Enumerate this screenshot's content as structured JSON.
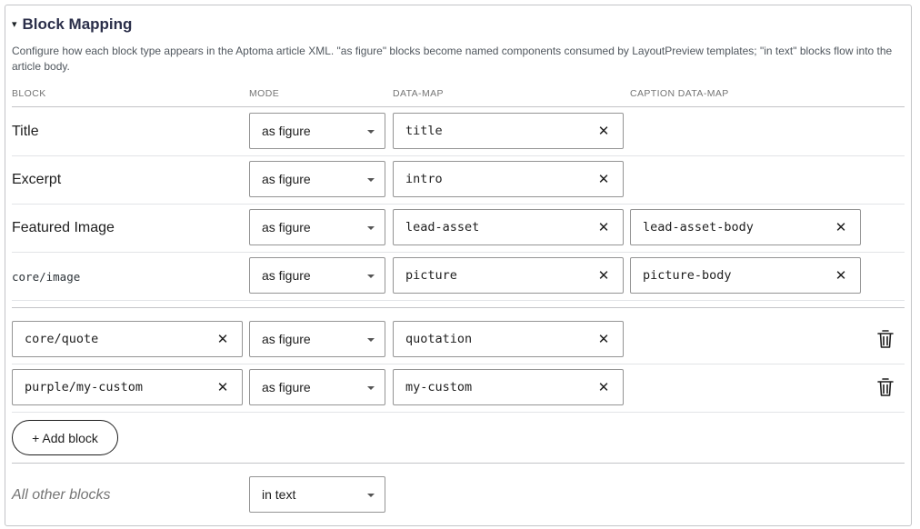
{
  "panel": {
    "title": "Block Mapping",
    "caret": "▾",
    "description": "Configure how each block type appears in the Aptoma article XML. \"as figure\" blocks become named components consumed by LayoutPreview templates; \"in text\" blocks flow into the article body."
  },
  "columns": {
    "block": "BLOCK",
    "mode": "MODE",
    "data_map": "DATA-MAP",
    "caption_data_map": "CAPTION DATA-MAP"
  },
  "builtin_rows": [
    {
      "label": "Title",
      "mode": "as figure",
      "data_map": "title",
      "caption": null
    },
    {
      "label": "Excerpt",
      "mode": "as figure",
      "data_map": "intro",
      "caption": null
    },
    {
      "label": "Featured Image",
      "mode": "as figure",
      "data_map": "lead-asset",
      "caption": "lead-asset-body"
    },
    {
      "label": "core/image",
      "mode": "as figure",
      "data_map": "picture",
      "caption": "picture-body"
    }
  ],
  "custom_rows": [
    {
      "block": "core/quote",
      "mode": "as figure",
      "data_map": "quotation"
    },
    {
      "block": "purple/my-custom",
      "mode": "as figure",
      "data_map": "my-custom"
    }
  ],
  "add_block_label": "+ Add block",
  "fallback": {
    "label": "All other blocks",
    "mode": "in text"
  },
  "icons": {
    "clear": "close-icon",
    "delete": "trash-icon",
    "dropdown": "chevron-down-icon"
  }
}
